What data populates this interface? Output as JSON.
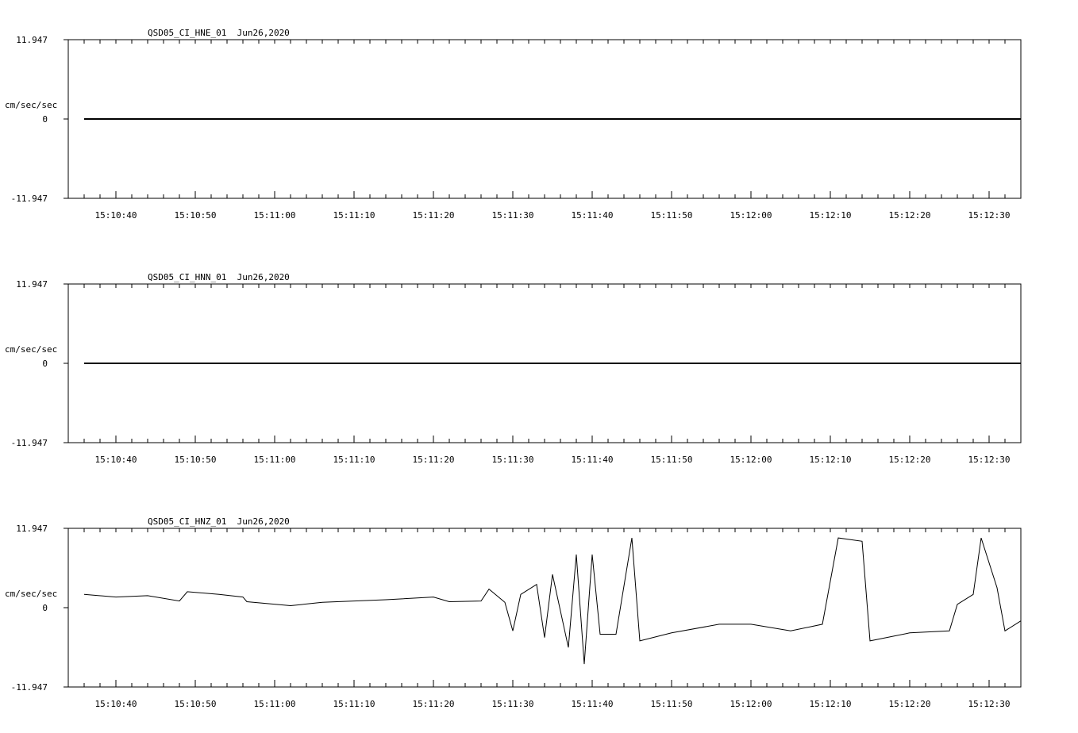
{
  "chart_data": [
    {
      "type": "line",
      "title": "QSD05_CI_HNE_01  Jun26,2020",
      "ylabel": "cm/sec/sec",
      "ylim": [
        -11.947,
        11.947
      ],
      "y_ticks": [
        "11.947",
        "0",
        "-11.947"
      ],
      "x_ticks": [
        "15:10:40",
        "15:10:50",
        "15:11:00",
        "15:11:10",
        "15:11:20",
        "15:11:30",
        "15:11:40",
        "15:11:50",
        "15:12:00",
        "15:12:10",
        "15:12:20",
        "15:12:30"
      ],
      "x_range_seconds": [
        "15:10:34",
        "15:12:34"
      ],
      "series": [
        {
          "points": [
            [
              "15:10:36",
              0
            ],
            [
              "15:12:34",
              0
            ]
          ]
        }
      ]
    },
    {
      "type": "line",
      "title": "QSD05_CI_HNN_01  Jun26,2020",
      "ylabel": "cm/sec/sec",
      "ylim": [
        -11.947,
        11.947
      ],
      "y_ticks": [
        "11.947",
        "0",
        "-11.947"
      ],
      "x_ticks": [
        "15:10:40",
        "15:10:50",
        "15:11:00",
        "15:11:10",
        "15:11:20",
        "15:11:30",
        "15:11:40",
        "15:11:50",
        "15:12:00",
        "15:12:10",
        "15:12:20",
        "15:12:30"
      ],
      "x_range_seconds": [
        "15:10:34",
        "15:12:34"
      ],
      "series": [
        {
          "points": [
            [
              "15:10:36",
              0
            ],
            [
              "15:12:34",
              0
            ]
          ]
        }
      ]
    },
    {
      "type": "line",
      "title": "QSD05_CI_HNZ_01  Jun26,2020",
      "ylabel": "cm/sec/sec",
      "ylim": [
        -11.947,
        11.947
      ],
      "y_ticks": [
        "11.947",
        "0",
        "-11.947"
      ],
      "x_ticks": [
        "15:10:40",
        "15:10:50",
        "15:11:00",
        "15:11:10",
        "15:11:20",
        "15:11:30",
        "15:11:40",
        "15:11:50",
        "15:12:00",
        "15:12:10",
        "15:12:20",
        "15:12:30"
      ],
      "x_range_seconds": [
        "15:10:34",
        "15:12:34"
      ],
      "series": [
        {
          "points": [
            [
              "15:10:36",
              2.0
            ],
            [
              "15:10:40",
              1.6
            ],
            [
              "15:10:44",
              1.8
            ],
            [
              "15:10:48",
              1.0
            ],
            [
              "15:10:49",
              2.4
            ],
            [
              "15:10:53",
              2.0
            ],
            [
              "15:10:56",
              1.6
            ],
            [
              "15:10:56.5",
              0.9
            ],
            [
              "15:11:02",
              0.3
            ],
            [
              "15:11:06",
              0.8
            ],
            [
              "15:11:14",
              1.2
            ],
            [
              "15:11:20",
              1.6
            ],
            [
              "15:11:22",
              0.9
            ],
            [
              "15:11:26",
              1.0
            ],
            [
              "15:11:27",
              2.8
            ],
            [
              "15:11:29",
              0.8
            ],
            [
              "15:11:30",
              -3.5
            ],
            [
              "15:11:31",
              2.0
            ],
            [
              "15:11:33",
              3.5
            ],
            [
              "15:11:34",
              -4.5
            ],
            [
              "15:11:35",
              5.0
            ],
            [
              "15:11:37",
              -6.0
            ],
            [
              "15:11:38",
              8.0
            ],
            [
              "15:11:39",
              -8.5
            ],
            [
              "15:11:40",
              8.0
            ],
            [
              "15:11:41",
              -4.0
            ],
            [
              "15:11:43",
              -4.0
            ],
            [
              "15:11:45",
              10.5
            ],
            [
              "15:11:46",
              -5.0
            ],
            [
              "15:11:50",
              -3.8
            ],
            [
              "15:11:56",
              -2.5
            ],
            [
              "15:12:00",
              -2.5
            ],
            [
              "15:12:05",
              -3.5
            ],
            [
              "15:12:09",
              -2.5
            ],
            [
              "15:12:11",
              10.5
            ],
            [
              "15:12:14",
              10.0
            ],
            [
              "15:12:15",
              -5.0
            ],
            [
              "15:12:20",
              -3.8
            ],
            [
              "15:12:25",
              -3.5
            ],
            [
              "15:12:26",
              0.5
            ],
            [
              "15:12:28",
              2.0
            ],
            [
              "15:12:29",
              10.5
            ],
            [
              "15:12:31",
              3.0
            ],
            [
              "15:12:32",
              -3.5
            ],
            [
              "15:12:34",
              -2.0
            ]
          ]
        }
      ]
    }
  ]
}
